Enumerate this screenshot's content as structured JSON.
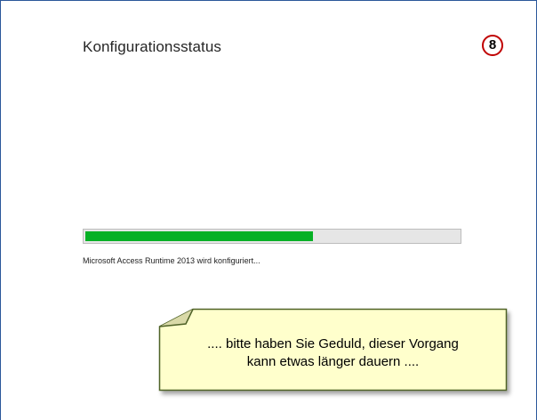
{
  "window": {
    "title": "Konfigurationsstatus",
    "step_badge": "8",
    "badge_color": "#c00000",
    "border_color": "#2b579a"
  },
  "progress": {
    "fraction": 0.61,
    "fill_color": "#06b025",
    "status_text": "Microsoft Access Runtime 2013 wird konfiguriert..."
  },
  "note": {
    "line1": ".... bitte haben Sie Geduld, dieser Vorgang",
    "line2": "kann etwas länger dauern ....",
    "fill_color": "#ffffcc",
    "border_color": "#4f6228"
  }
}
